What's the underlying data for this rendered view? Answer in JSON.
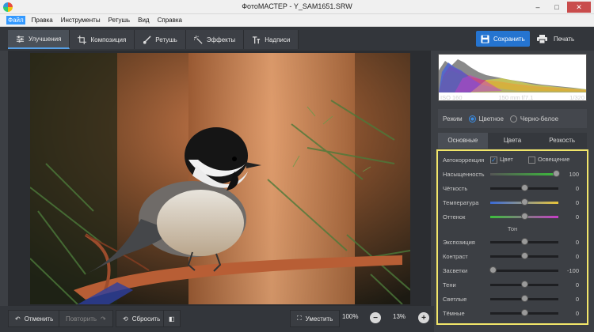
{
  "window": {
    "title": "ФотоМАСТЕР - Y_SAM1651.SRW"
  },
  "menu": [
    "Файл",
    "Правка",
    "Инструменты",
    "Ретушь",
    "Вид",
    "Справка"
  ],
  "tabs": [
    "Улучшения",
    "Композиция",
    "Ретушь",
    "Эффекты",
    "Надписи"
  ],
  "actions": {
    "save": "Сохранить",
    "print": "Печать"
  },
  "bottom": {
    "undo": "Отменить",
    "redo": "Повторить",
    "reset": "Сбросить",
    "fit": "Уместить",
    "zoom_100": "100%",
    "zoom": "13%"
  },
  "histogram": {
    "iso": "ISO 160",
    "lens": "150 mm f/7.1",
    "shutter": "1/320"
  },
  "mode": {
    "label": "Режим",
    "color": "Цветное",
    "bw": "Черно-белое"
  },
  "panel_tabs": [
    "Основные",
    "Цвета",
    "Резкость"
  ],
  "auto": {
    "label": "Автокоррекция",
    "color": "Цвет",
    "light": "Освещение"
  },
  "section_tone": "Тон",
  "sliders": [
    {
      "label": "Насыщенность",
      "value": "100",
      "pos": 1.0,
      "track": "saturation"
    },
    {
      "label": "Чёткость",
      "value": "0",
      "pos": 0.5,
      "track": "plain"
    },
    {
      "label": "Температура",
      "value": "0",
      "pos": 0.5,
      "track": "temperature"
    },
    {
      "label": "Оттенок",
      "value": "0",
      "pos": 0.5,
      "track": "tint"
    }
  ],
  "tone_sliders": [
    {
      "label": "Экспозиция",
      "value": "0",
      "pos": 0.5,
      "track": "plain"
    },
    {
      "label": "Контраст",
      "value": "0",
      "pos": 0.5,
      "track": "plain"
    },
    {
      "label": "Засветки",
      "value": "-100",
      "pos": 0.0,
      "track": "plain"
    },
    {
      "label": "Тени",
      "value": "0",
      "pos": 0.5,
      "track": "plain"
    },
    {
      "label": "Светлые",
      "value": "0",
      "pos": 0.5,
      "track": "plain"
    },
    {
      "label": "Тёмные",
      "value": "0",
      "pos": 0.5,
      "track": "plain"
    }
  ]
}
